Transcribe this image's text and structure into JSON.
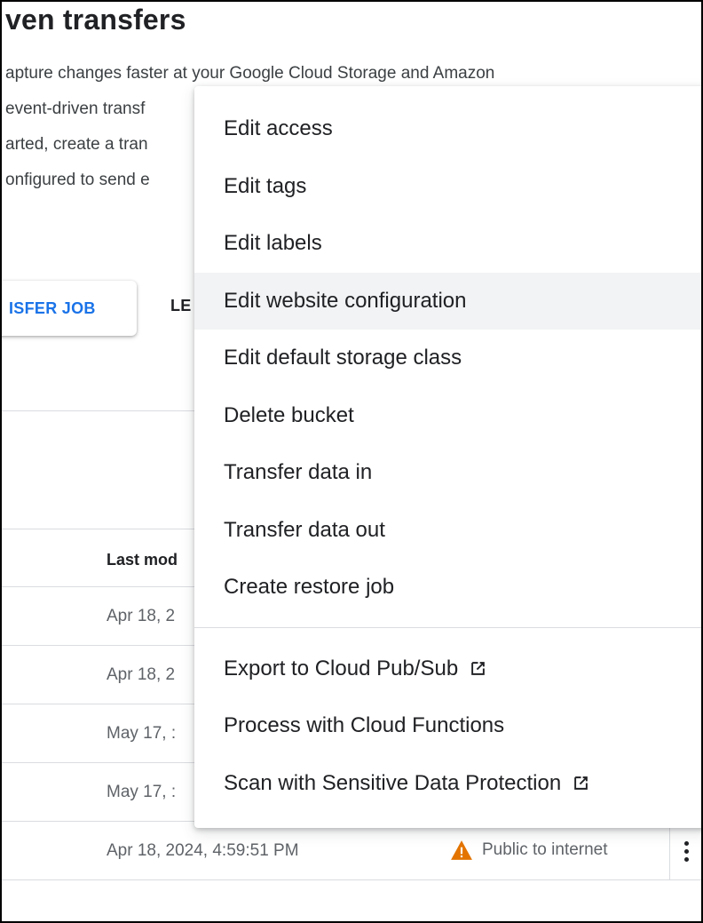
{
  "page": {
    "heading": "ven transfers",
    "description_lines": [
      "apture changes faster at your Google Cloud Storage and Amazon",
      "event-driven transf",
      "arted, create a tran",
      "onfigured to send e"
    ],
    "create_button_label": "ISFER JOB",
    "learn_button_label": "LE"
  },
  "table": {
    "column_last_modified": "Last mod",
    "rows": [
      {
        "last_modified": "Apr 18, 2",
        "access": ""
      },
      {
        "last_modified": "Apr 18, 2",
        "access": ""
      },
      {
        "last_modified": "May 17, :",
        "access": ""
      },
      {
        "last_modified": "May 17, :",
        "access": ""
      },
      {
        "last_modified": "Apr 18, 2024, 4:59:51 PM",
        "access": "Public to internet"
      }
    ]
  },
  "context_menu": {
    "items": [
      {
        "label": "Edit access",
        "external": false
      },
      {
        "label": "Edit tags",
        "external": false
      },
      {
        "label": "Edit labels",
        "external": false
      },
      {
        "label": "Edit website configuration",
        "external": false,
        "hover": true
      },
      {
        "label": "Edit default storage class",
        "external": false
      },
      {
        "label": "Delete bucket",
        "external": false
      },
      {
        "label": "Transfer data in",
        "external": false
      },
      {
        "label": "Transfer data out",
        "external": false
      },
      {
        "label": "Create restore job",
        "external": false
      }
    ],
    "secondary_items": [
      {
        "label": "Export to Cloud Pub/Sub",
        "external": true
      },
      {
        "label": "Process with Cloud Functions",
        "external": false
      },
      {
        "label": "Scan with Sensitive Data Protection",
        "external": true
      }
    ]
  },
  "colors": {
    "accent_blue": "#1a73e8",
    "warning_orange": "#e37400",
    "text_primary": "#202124",
    "text_secondary": "#5f6368",
    "divider": "#dadce0",
    "hover_bg": "#f1f3f4"
  },
  "icons": {
    "warning": "warning-triangle-icon",
    "external_link": "open-in-new-icon",
    "more_actions": "more-vert-icon"
  }
}
